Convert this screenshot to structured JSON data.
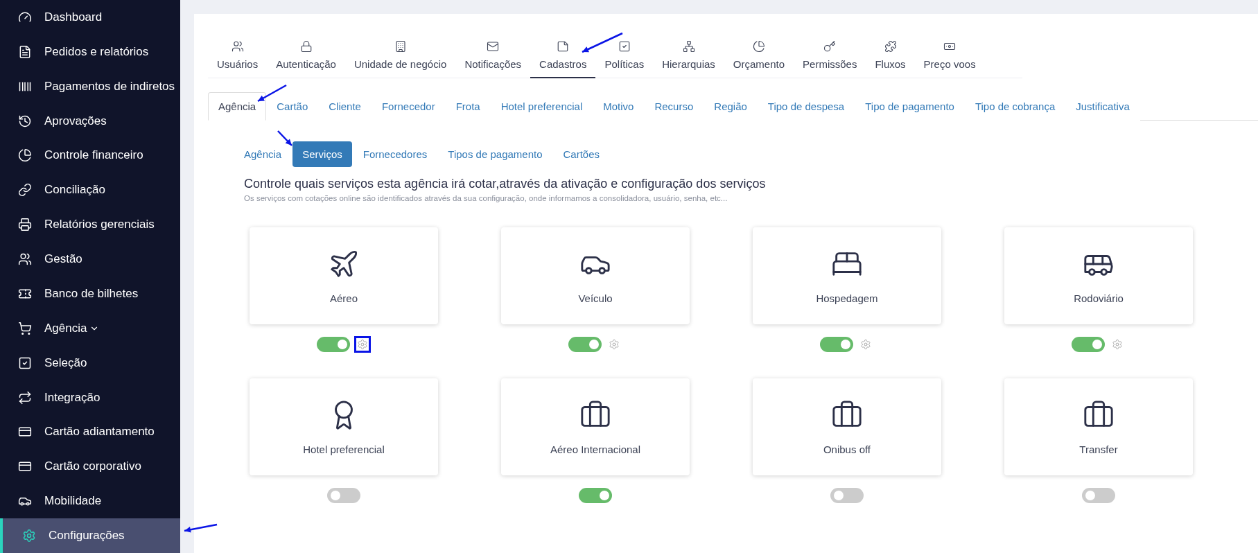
{
  "sidebar": {
    "items": [
      {
        "label": "Dashboard",
        "selected": false,
        "dropdown": false
      },
      {
        "label": "Pedidos e relatórios",
        "selected": false,
        "dropdown": false
      },
      {
        "label": "Pagamentos de indiretos",
        "selected": false,
        "dropdown": false
      },
      {
        "label": "Aprovações",
        "selected": false,
        "dropdown": false
      },
      {
        "label": "Controle financeiro",
        "selected": false,
        "dropdown": false
      },
      {
        "label": "Conciliação",
        "selected": false,
        "dropdown": false
      },
      {
        "label": "Relatórios gerenciais",
        "selected": false,
        "dropdown": false
      },
      {
        "label": "Gestão",
        "selected": false,
        "dropdown": false
      },
      {
        "label": "Banco de bilhetes",
        "selected": false,
        "dropdown": false
      },
      {
        "label": "Agência",
        "selected": false,
        "dropdown": true
      },
      {
        "label": "Seleção",
        "selected": false,
        "dropdown": false
      },
      {
        "label": "Integração",
        "selected": false,
        "dropdown": false
      },
      {
        "label": "Cartão adiantamento",
        "selected": false,
        "dropdown": false
      },
      {
        "label": "Cartão corporativo",
        "selected": false,
        "dropdown": false
      },
      {
        "label": "Mobilidade",
        "selected": false,
        "dropdown": false
      },
      {
        "label": "Configurações",
        "selected": true,
        "dropdown": false
      }
    ]
  },
  "settings_tabs": [
    {
      "label": "Usuários",
      "selected": false
    },
    {
      "label": "Autenticação",
      "selected": false
    },
    {
      "label": "Unidade de negócio",
      "selected": false
    },
    {
      "label": "Notificações",
      "selected": false
    },
    {
      "label": "Cadastros",
      "selected": true
    },
    {
      "label": "Políticas",
      "selected": false
    },
    {
      "label": "Hierarquias",
      "selected": false
    },
    {
      "label": "Orçamento",
      "selected": false
    },
    {
      "label": "Permissões",
      "selected": false
    },
    {
      "label": "Fluxos",
      "selected": false
    },
    {
      "label": "Preço voos",
      "selected": false
    }
  ],
  "register_tabs": [
    {
      "label": "Agência",
      "selected": true
    },
    {
      "label": "Cartão",
      "selected": false
    },
    {
      "label": "Cliente",
      "selected": false
    },
    {
      "label": "Fornecedor",
      "selected": false
    },
    {
      "label": "Frota",
      "selected": false
    },
    {
      "label": "Hotel preferencial",
      "selected": false
    },
    {
      "label": "Motivo",
      "selected": false
    },
    {
      "label": "Recurso",
      "selected": false
    },
    {
      "label": "Região",
      "selected": false
    },
    {
      "label": "Tipo de despesa",
      "selected": false
    },
    {
      "label": "Tipo de pagamento",
      "selected": false
    },
    {
      "label": "Tipo de cobrança",
      "selected": false
    },
    {
      "label": "Justificativa",
      "selected": false
    }
  ],
  "agency_tabs": [
    {
      "label": "Agência",
      "selected": false
    },
    {
      "label": "Serviços",
      "selected": true
    },
    {
      "label": "Fornecedores",
      "selected": false
    },
    {
      "label": "Tipos de pagamento",
      "selected": false
    },
    {
      "label": "Cartões",
      "selected": false
    }
  ],
  "heading": "Controle quais serviços esta agência irá cotar,através da ativação e configuração dos serviços",
  "subheading": "Os serviços com cotações online são identificados através da sua configuração, onde informamos a consolidadora, usuário, senha, etc...",
  "services": [
    {
      "label": "Aéreo",
      "kind": "plane",
      "on": true,
      "configurable": true,
      "highlighted": true
    },
    {
      "label": "Veículo",
      "kind": "car",
      "on": true,
      "configurable": true,
      "highlighted": false
    },
    {
      "label": "Hospedagem",
      "kind": "bed",
      "on": true,
      "configurable": true,
      "highlighted": false
    },
    {
      "label": "Rodoviário",
      "kind": "bus",
      "on": true,
      "configurable": true,
      "highlighted": false
    },
    {
      "label": "Hotel preferencial",
      "kind": "award",
      "on": false,
      "configurable": false
    },
    {
      "label": "Aéreo Internacional",
      "kind": "suitcase",
      "on": true,
      "configurable": false
    },
    {
      "label": "Onibus off",
      "kind": "suitcase",
      "on": false,
      "configurable": false
    },
    {
      "label": "Transfer",
      "kind": "suitcase",
      "on": false,
      "configurable": false
    }
  ]
}
